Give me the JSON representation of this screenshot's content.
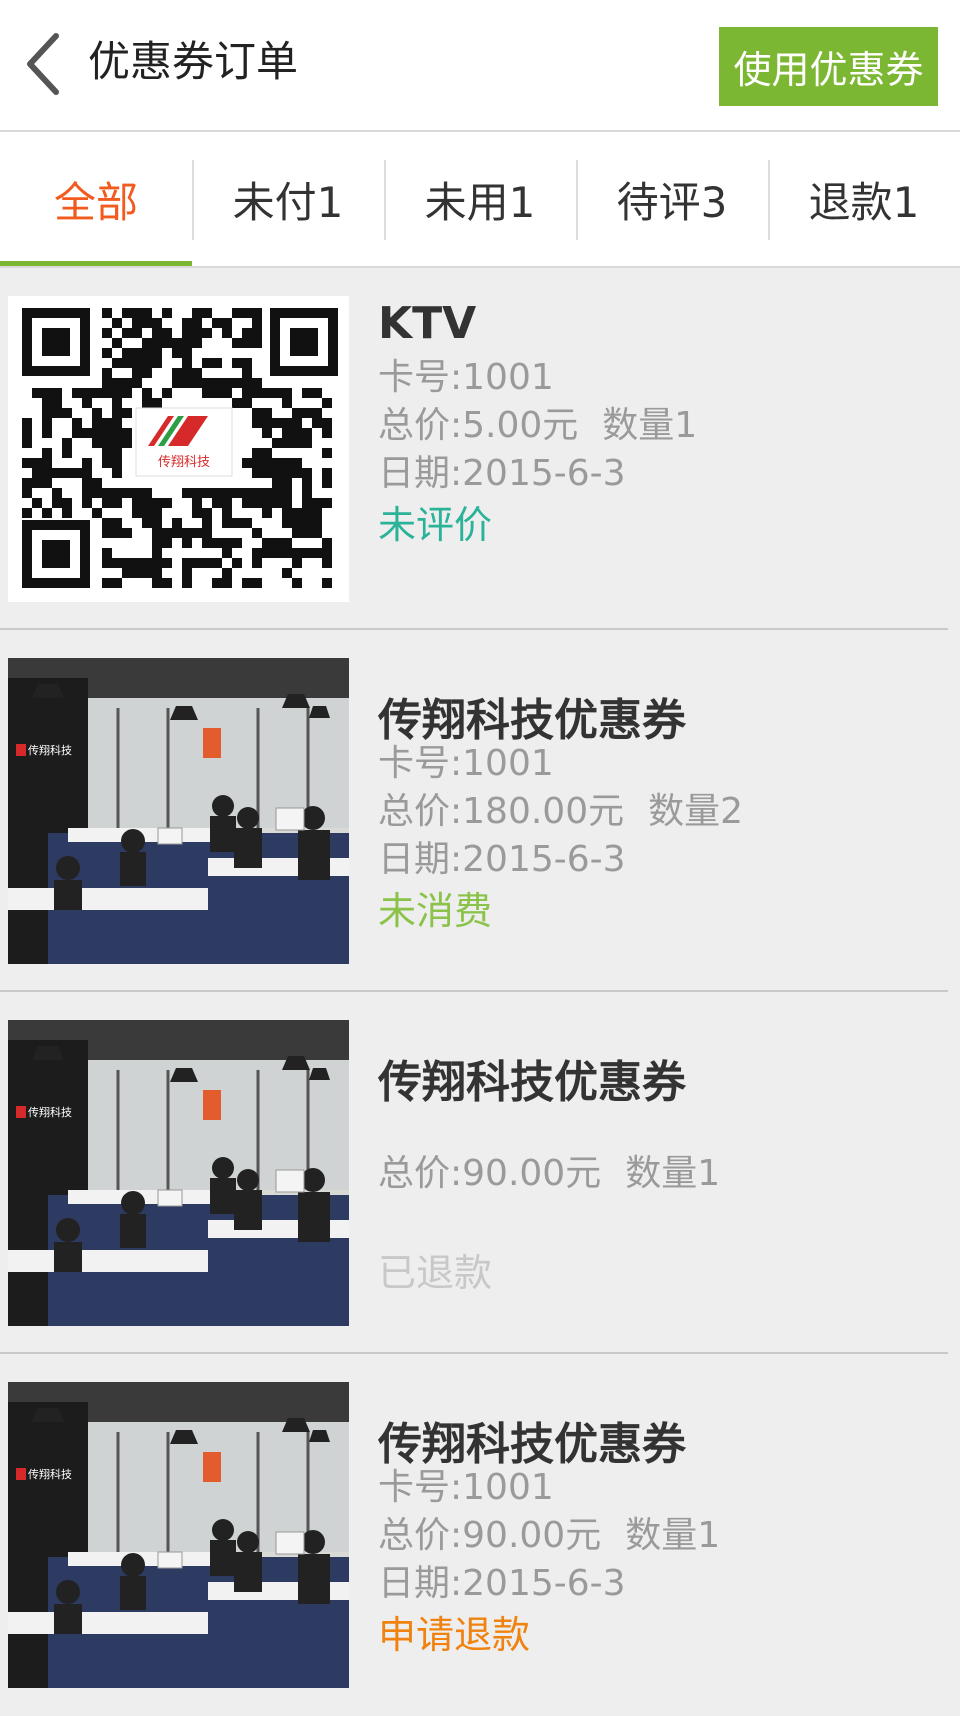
{
  "header": {
    "title": "优惠券订单",
    "use_button": "使用优惠券"
  },
  "tabs": [
    {
      "label": "全部",
      "active": true
    },
    {
      "label": "未付1",
      "active": false
    },
    {
      "label": "未用1",
      "active": false
    },
    {
      "label": "待评3",
      "active": false
    },
    {
      "label": "退款1",
      "active": false
    }
  ],
  "colors": {
    "accent_green": "#7cb734",
    "active_tab": "#f25a1e",
    "status_teal": "#2bb39a",
    "status_green": "#8bc34a",
    "status_gray": "#c8c8c8",
    "status_orange": "#f0820f"
  },
  "orders": [
    {
      "image": "qr-code",
      "name": "KTV",
      "card": "卡号:1001",
      "total": "总价:5.00元",
      "qty": "数量1",
      "date": "日期:2015-6-3",
      "status": "未评价"
    },
    {
      "image": "office-photo",
      "name": "传翔科技优惠券",
      "card": "卡号:1001",
      "total": "总价:180.00元",
      "qty": "数量2",
      "date": "日期:2015-6-3",
      "status": "未消费"
    },
    {
      "image": "office-photo",
      "name": "传翔科技优惠券",
      "card": "",
      "total": "总价:90.00元",
      "qty": "数量1",
      "date": "",
      "status": "已退款"
    },
    {
      "image": "office-photo",
      "name": "传翔科技优惠券",
      "card": "卡号:1001",
      "total": "总价:90.00元",
      "qty": "数量1",
      "date": "日期:2015-6-3",
      "status": "申请退款"
    }
  ],
  "logo_text": "传翔科技"
}
